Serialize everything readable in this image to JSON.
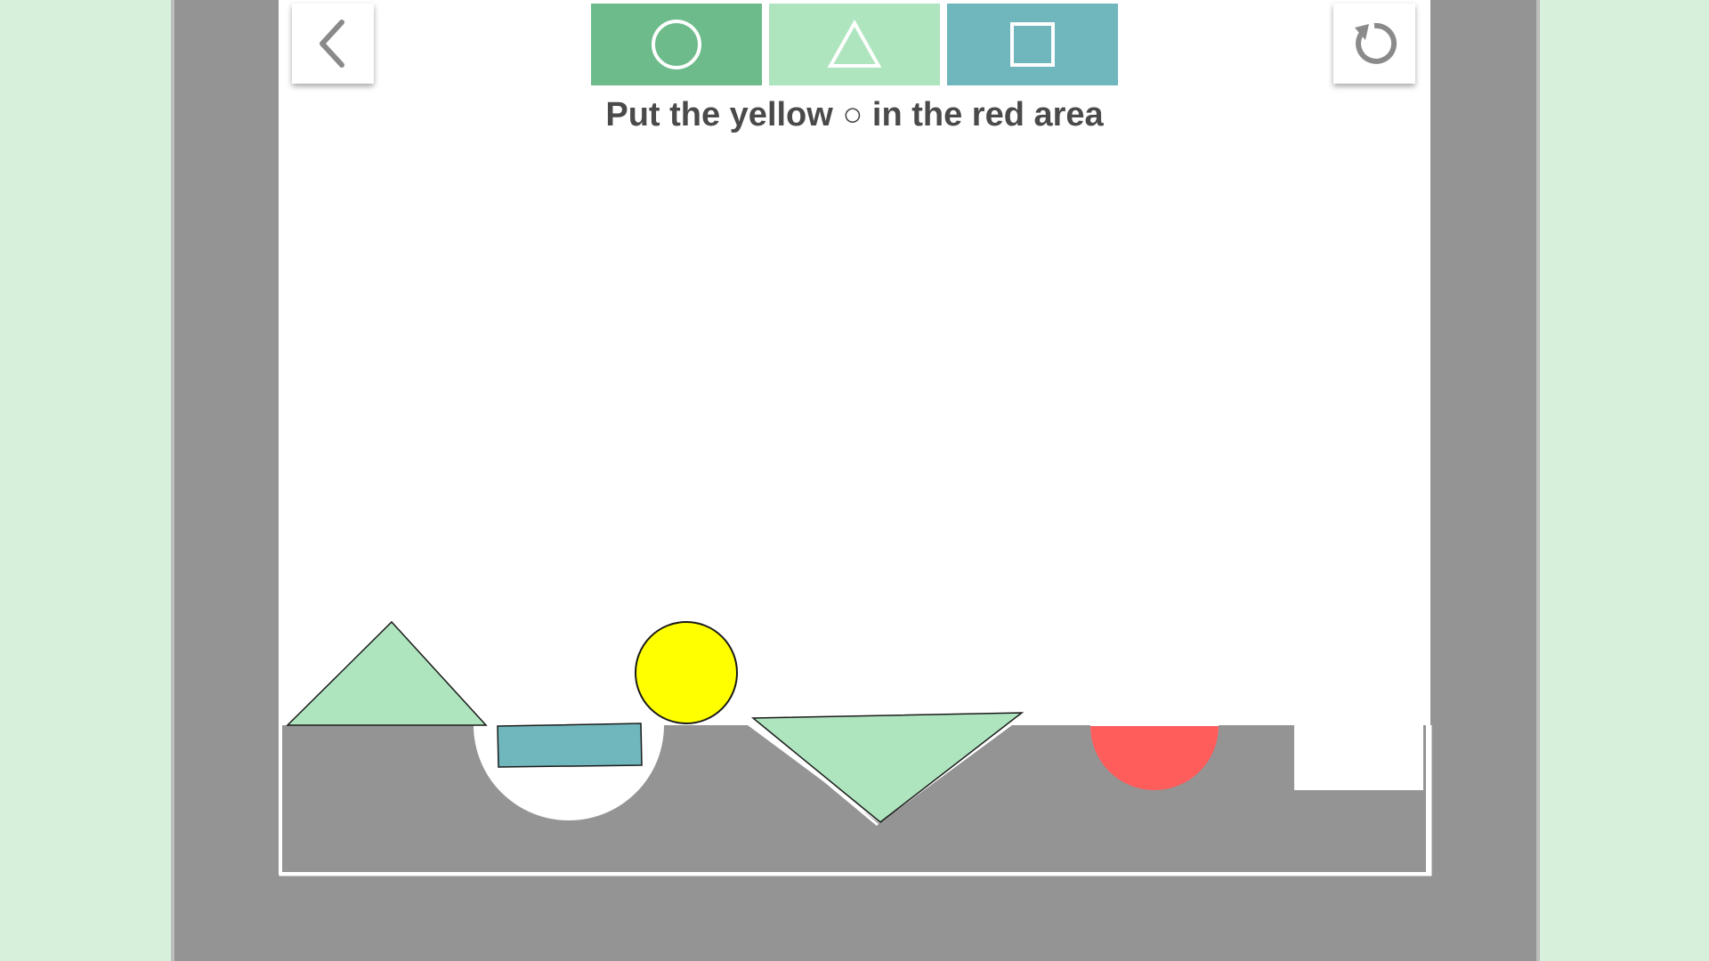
{
  "instruction": "Put the yellow ○ in the red area",
  "toolbar": {
    "back_icon": "chevron-left-icon",
    "reset_icon": "restart-icon",
    "shape_buttons": [
      {
        "shape": "circle",
        "icon": "circle-icon",
        "color": "#6dbb8b"
      },
      {
        "shape": "triangle",
        "icon": "triangle-icon",
        "color": "#aee5be"
      },
      {
        "shape": "square",
        "icon": "square-icon",
        "color": "#6fb7bd"
      }
    ]
  },
  "colors": {
    "background": "#d6f0dc",
    "frame": "#949494",
    "play_area": "#ffffff",
    "ground": "#949494",
    "target_area": "#ff5c5c",
    "ball": "#ffff00",
    "triangle": "#aee5be",
    "block": "#6fb7bd",
    "text": "#4a4a4a"
  }
}
